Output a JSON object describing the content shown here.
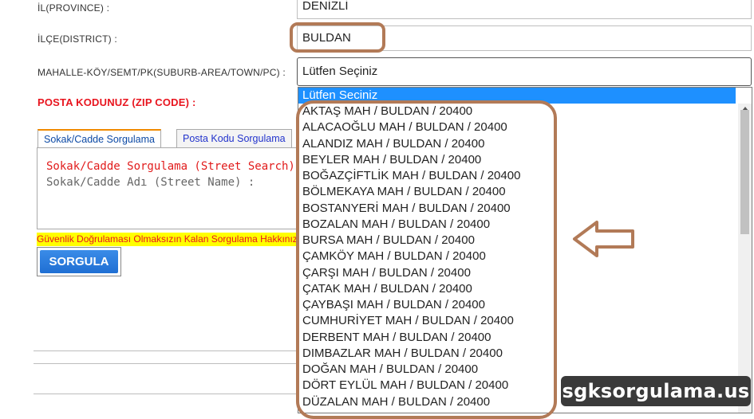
{
  "form": {
    "province_label": "İL(PROVINCE) :",
    "province_value": "DENİZLİ",
    "district_label": "İLÇE(DISTRICT) :",
    "district_value": "BULDAN",
    "suburb_label": "MAHALLE-KÖY/SEMT/PK(SUBURB-AREA/TOWN/PC) :",
    "suburb_value": "Lütfen Seçiniz",
    "zip_label": "POSTA KODUNUZ (ZIP CODE) :"
  },
  "tabs": {
    "street": "Sokak/Cadde Sorgulama",
    "zip": "Posta Kodu Sorgulama"
  },
  "panel": {
    "title": "Sokak/Cadde Sorgulama (Street Search)",
    "street_name_label": "Sokak/Cadde Adı (Street Name) :"
  },
  "notice": "Güvenlik Doğrulaması Olmaksızın Kalan Sorgulama Hakkınız",
  "button": {
    "query": "SORGULA"
  },
  "dropdown": {
    "selected": "Lütfen Seciniz",
    "options": [
      "AKTAŞ MAH / BULDAN / 20400",
      "ALACAOĞLU MAH / BULDAN / 20400",
      "ALANDIZ MAH / BULDAN / 20400",
      "BEYLER MAH / BULDAN / 20400",
      "BOĞAZÇİFTLİK MAH / BULDAN / 20400",
      "BÖLMEKAYA MAH / BULDAN / 20400",
      "BOSTANYERİ MAH / BULDAN / 20400",
      "BOZALAN MAH / BULDAN / 20400",
      "BURSA MAH / BULDAN / 20400",
      "ÇAMKÖY MAH / BULDAN / 20400",
      "ÇARŞI MAH / BULDAN / 20400",
      "ÇATAK MAH / BULDAN / 20400",
      "ÇAYBAŞI MAH / BULDAN / 20400",
      "CUMHURİYET MAH / BULDAN / 20400",
      "DERBENT MAH / BULDAN / 20400",
      "DIMBAZLAR MAH / BULDAN / 20400",
      "DOĞAN MAH / BULDAN / 20400",
      "DÖRT EYLÜL MAH / BULDAN / 20400",
      "DÜZALAN MAH / BULDAN / 20400"
    ]
  },
  "watermark": "sgksorgulama.us",
  "colors": {
    "highlight_outline": "#b27a57",
    "selected_option": "#1e90ff",
    "label_red": "#e8141e",
    "notice_bg": "#ffff00",
    "button_blue": "#1f6fd3"
  }
}
